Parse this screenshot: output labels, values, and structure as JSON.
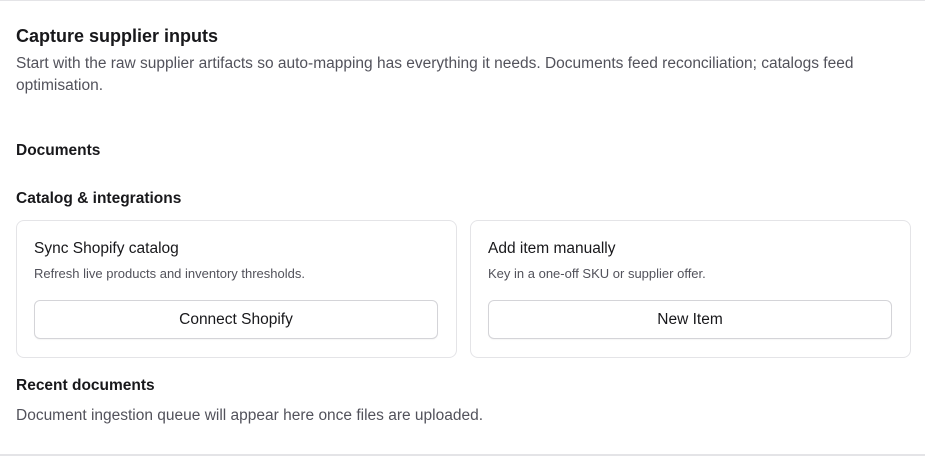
{
  "header": {
    "title": "Capture supplier inputs",
    "description": "Start with the raw supplier artifacts so auto-mapping has everything it needs. Documents feed reconciliation; catalogs feed optimisation."
  },
  "sections": {
    "documents": {
      "heading": "Documents"
    },
    "catalog": {
      "heading": "Catalog & integrations",
      "cards": [
        {
          "title": "Sync Shopify catalog",
          "description": "Refresh live products and inventory thresholds.",
          "button_label": "Connect Shopify"
        },
        {
          "title": "Add item manually",
          "description": "Key in a one-off SKU or supplier offer.",
          "button_label": "New Item"
        }
      ]
    },
    "recent_documents": {
      "heading": "Recent documents",
      "empty_message": "Document ingestion queue will appear here once files are uploaded."
    }
  },
  "colors": {
    "text_primary": "#18181b",
    "text_muted": "#52525b",
    "border": "#e4e4e7"
  }
}
